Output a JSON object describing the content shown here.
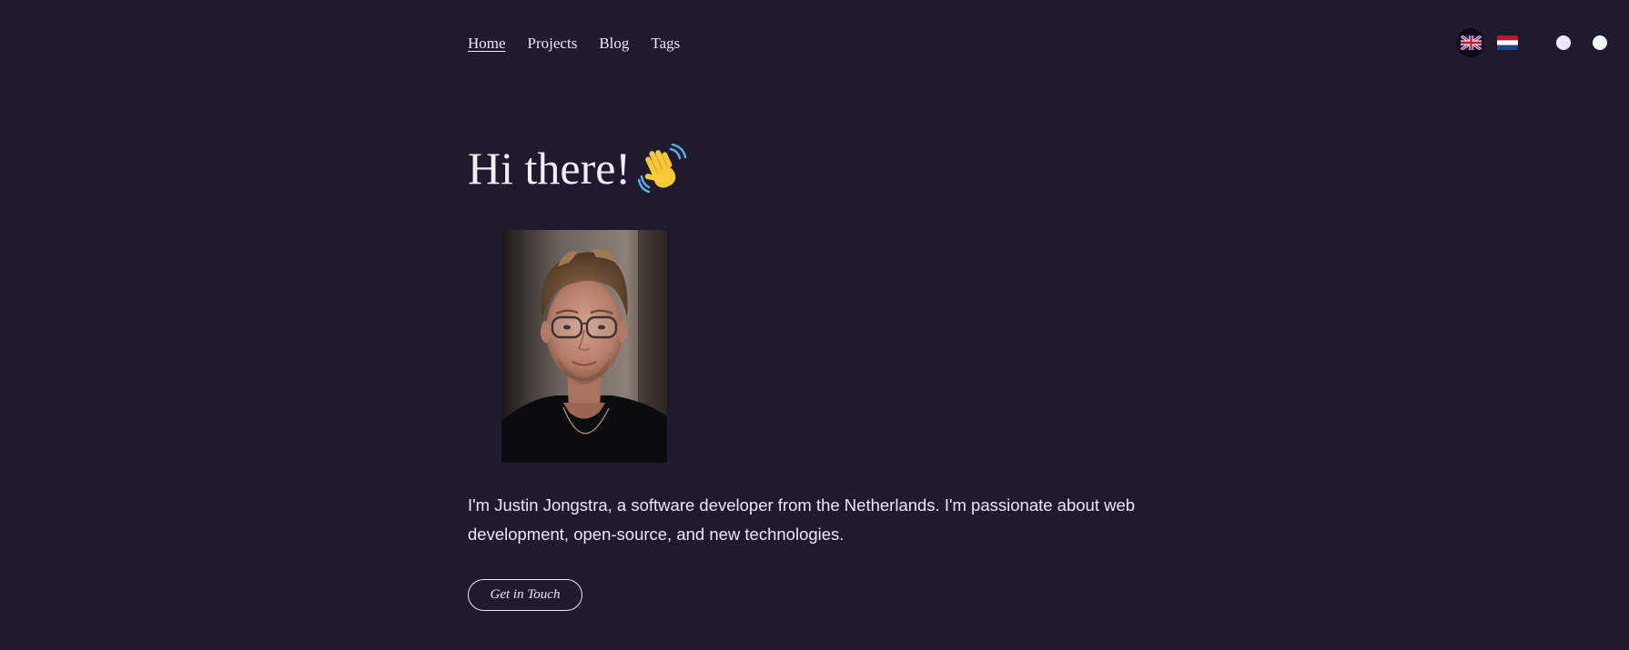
{
  "nav": {
    "items": [
      {
        "label": "Home",
        "active": true
      },
      {
        "label": "Projects",
        "active": false
      },
      {
        "label": "Blog",
        "active": false
      },
      {
        "label": "Tags",
        "active": false
      }
    ]
  },
  "controls": {
    "languages": [
      {
        "icon": "uk-flag-icon",
        "active": true
      },
      {
        "icon": "netherlands-flag-icon",
        "active": false
      }
    ],
    "theme_dots": [
      {
        "color": "#ece8fb"
      },
      {
        "color": "#f3fbf4"
      }
    ]
  },
  "hero": {
    "heading": "Hi there!",
    "emoji_icon": "waving-hand-icon",
    "intro": "I'm Justin Jongstra, a software developer from the Netherlands. I'm passionate about web development, open-source, and new technologies.",
    "cta_label": "Get in Touch"
  },
  "colors": {
    "background": "#201a2e",
    "text": "#ece8f4"
  }
}
